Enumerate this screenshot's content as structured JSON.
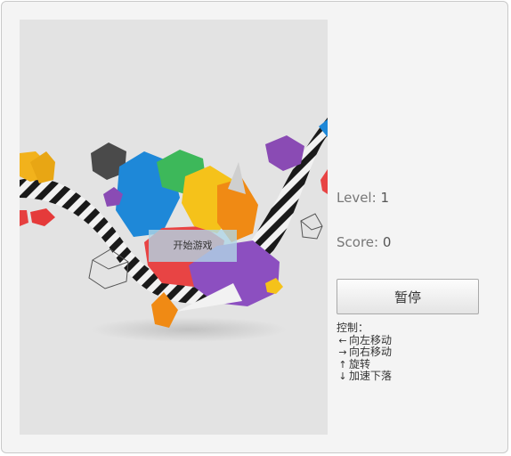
{
  "game": {
    "start_label": "开始游戏",
    "level_label": "Level:",
    "level_value": "1",
    "score_label": "Score:",
    "score_value": "0",
    "pause_label": "暂停"
  },
  "controls": {
    "title": "控制：",
    "items": [
      {
        "icon": "arrow-left-icon",
        "label": "向左移动"
      },
      {
        "icon": "arrow-right-icon",
        "label": "向右移动"
      },
      {
        "icon": "arrow-up-icon",
        "label": "旋转"
      },
      {
        "icon": "arrow-down-icon",
        "label": "加速下落"
      }
    ]
  },
  "colors": {
    "board_bg": "#e2e2e2",
    "start_button": "#b0d6e6",
    "panel_bg": "#f4f4f4"
  }
}
